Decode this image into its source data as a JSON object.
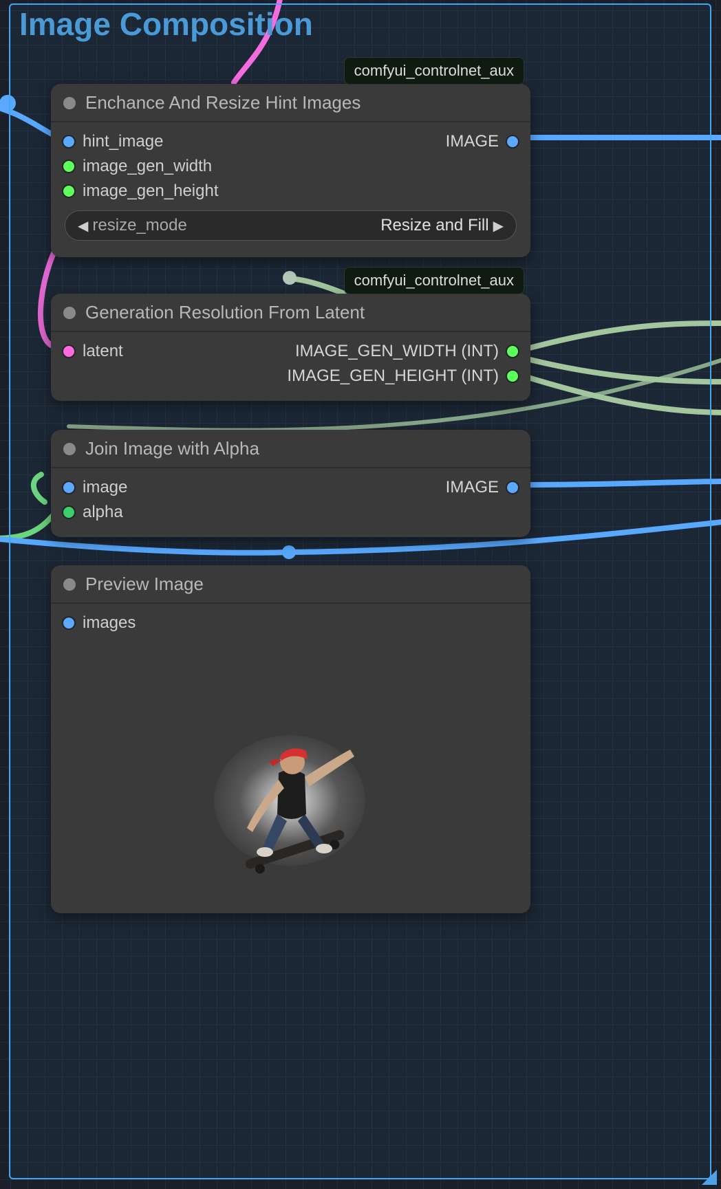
{
  "group": {
    "title": "Image Composition"
  },
  "badges": {
    "n1": "comfyui_controlnet_aux",
    "n2": "comfyui_controlnet_aux"
  },
  "nodes": {
    "enhance": {
      "title": "Enchance And Resize Hint Images",
      "inputs": {
        "hint_image": "hint_image",
        "image_gen_width": "image_gen_width",
        "image_gen_height": "image_gen_height"
      },
      "outputs": {
        "image": "IMAGE"
      },
      "widget": {
        "name": "resize_mode",
        "value": "Resize and Fill"
      }
    },
    "genres": {
      "title": "Generation Resolution From Latent",
      "inputs": {
        "latent": "latent"
      },
      "outputs": {
        "w": "IMAGE_GEN_WIDTH (INT)",
        "h": "IMAGE_GEN_HEIGHT (INT)"
      }
    },
    "joinalpha": {
      "title": "Join Image with Alpha",
      "inputs": {
        "image": "image",
        "alpha": "alpha"
      },
      "outputs": {
        "image": "IMAGE"
      }
    },
    "preview": {
      "title": "Preview Image",
      "inputs": {
        "images": "images"
      }
    }
  },
  "colors": {
    "wire_blue": "#5aa8ff",
    "wire_green": "#a8c99a",
    "wire_pink": "#ff6adf",
    "wire_midgreen": "#6fd87a"
  }
}
